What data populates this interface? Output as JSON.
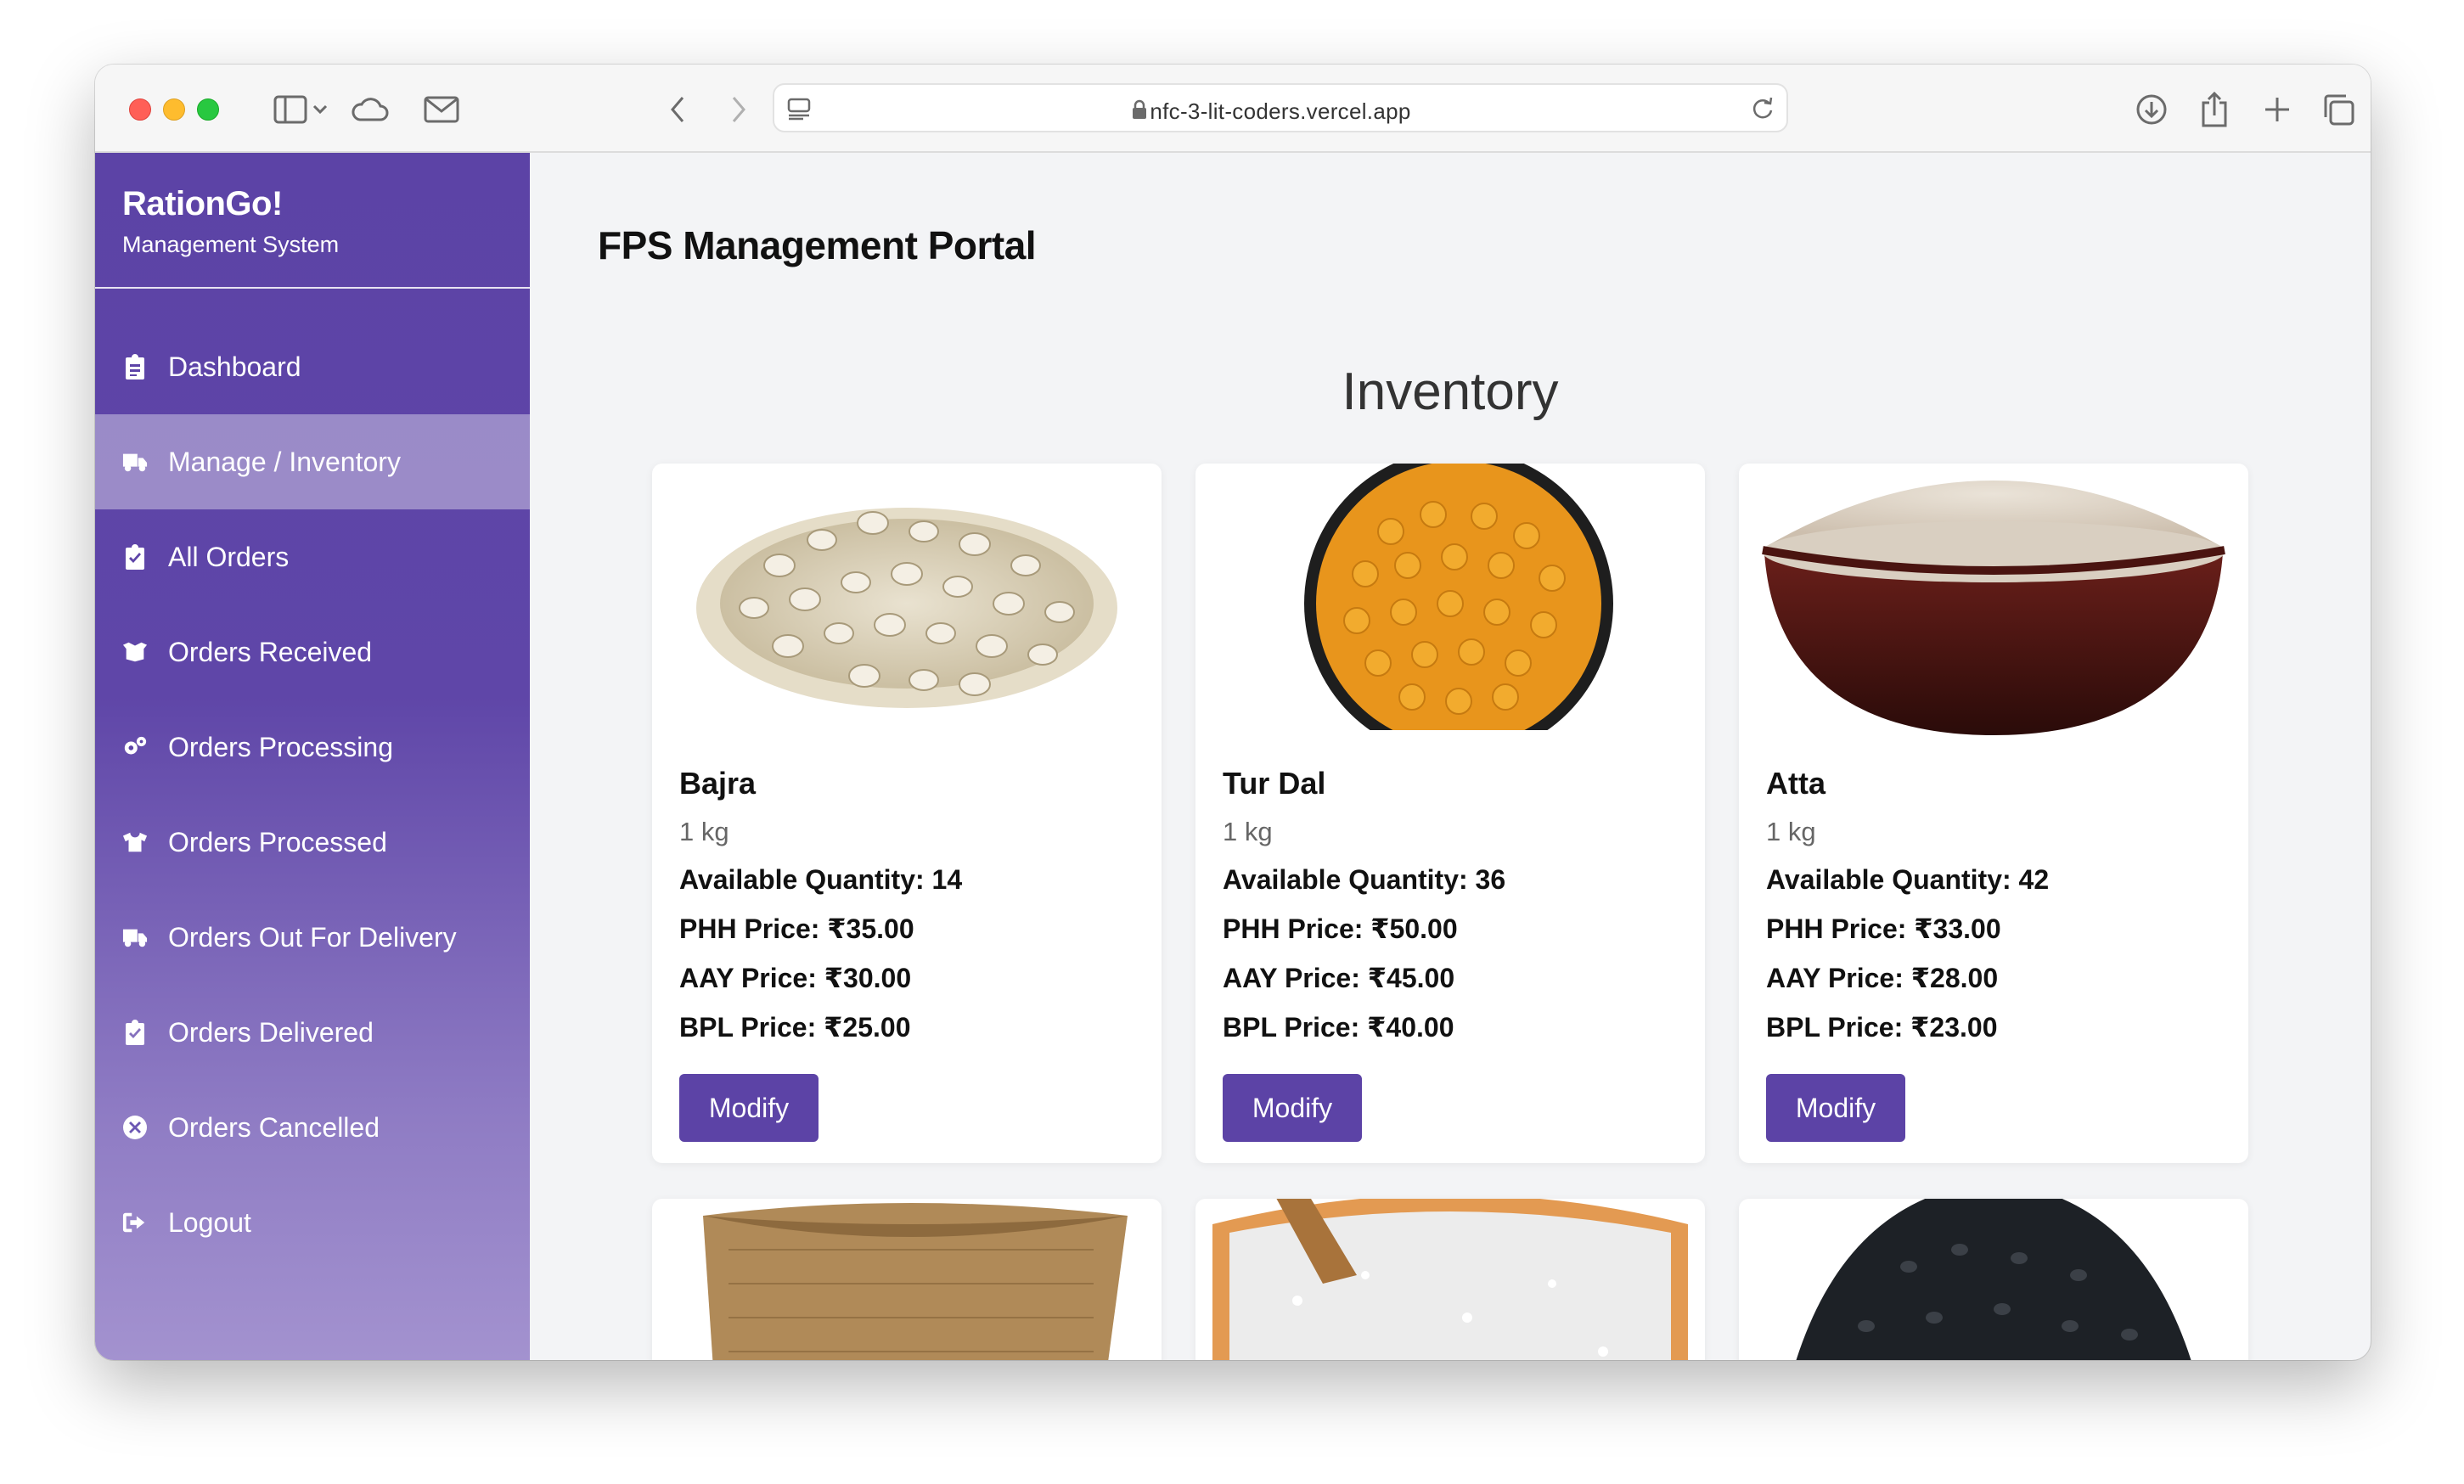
{
  "browser": {
    "url": "nfc-3-lit-coders.vercel.app"
  },
  "sidebar": {
    "brand_title": "RationGo!",
    "brand_subtitle": "Management System",
    "items": [
      {
        "label": "Dashboard",
        "icon": "clipboard-list-icon",
        "active": false
      },
      {
        "label": "Manage / Inventory",
        "icon": "truck-icon",
        "active": true
      },
      {
        "label": "All Orders",
        "icon": "clipboard-check-icon",
        "active": false
      },
      {
        "label": "Orders Received",
        "icon": "box-open-icon",
        "active": false
      },
      {
        "label": "Orders Processing",
        "icon": "gears-icon",
        "active": false
      },
      {
        "label": "Orders Processed",
        "icon": "shirt-icon",
        "active": false
      },
      {
        "label": "Orders Out For Delivery",
        "icon": "delivery-truck-icon",
        "active": false
      },
      {
        "label": "Orders Delivered",
        "icon": "clipboard-check-icon",
        "active": false
      },
      {
        "label": "Orders Cancelled",
        "icon": "circle-x-icon",
        "active": false
      },
      {
        "label": "Logout",
        "icon": "sign-out-icon",
        "active": false
      }
    ]
  },
  "main": {
    "portal_title": "FPS Management Portal",
    "inventory_title": "Inventory",
    "modify_label": "Modify",
    "products": [
      {
        "name": "Bajra",
        "unit": "1 kg",
        "available": "Available Quantity: 14",
        "phh": "PHH Price: ₹35.00",
        "aay": "AAY Price: ₹30.00",
        "bpl": "BPL Price: ₹25.00",
        "image": "bajra-grains-image"
      },
      {
        "name": "Tur Dal",
        "unit": "1 kg",
        "available": "Available Quantity: 36",
        "phh": "PHH Price: ₹50.00",
        "aay": "AAY Price: ₹45.00",
        "bpl": "BPL Price: ₹40.00",
        "image": "tur-dal-bowl-image"
      },
      {
        "name": "Atta",
        "unit": "1 kg",
        "available": "Available Quantity: 42",
        "phh": "PHH Price: ₹33.00",
        "aay": "AAY Price: ₹28.00",
        "bpl": "BPL Price: ₹23.00",
        "image": "atta-flour-bowl-image"
      }
    ],
    "more_products": [
      "jute-sack-image",
      "sugar-bowl-image",
      "black-urad-image"
    ]
  },
  "colors": {
    "accent": "#5c43a6",
    "page_bg": "#f3f4f6"
  }
}
